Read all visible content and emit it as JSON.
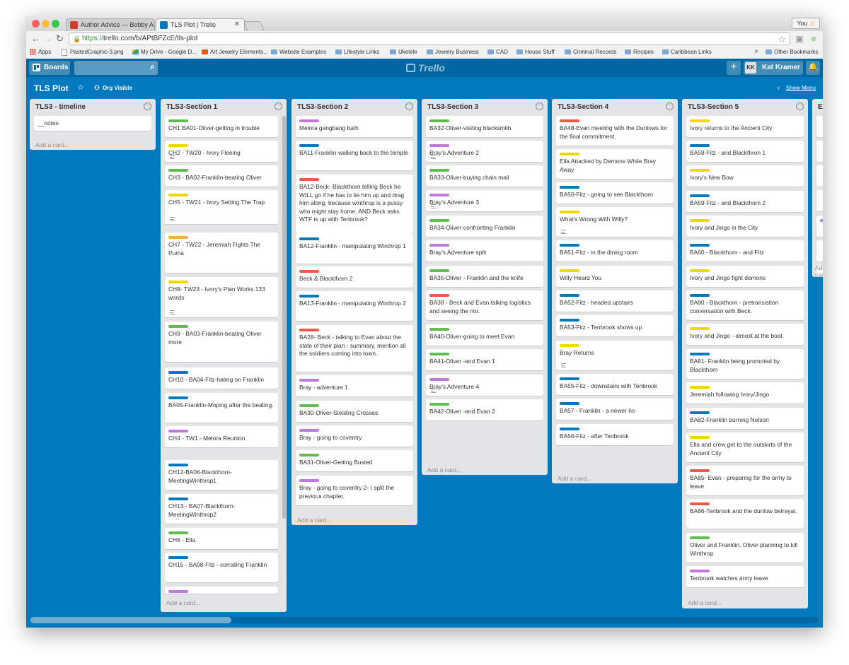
{
  "browser": {
    "tabs": [
      {
        "label": "Author Advice — Bobby A...",
        "favicon_color": "#d33b2c"
      },
      {
        "label": "TLS Plot | Trello",
        "favicon_color": "#0079bf"
      }
    ],
    "profile": "You",
    "url_scheme": "https://",
    "url_rest": "trello.com/b/APtBFZcE/tls-plot",
    "bookmarks": [
      "Apps",
      "PastedGraphic-3.png",
      "My Drive - Google D...",
      "Art Jewelry Elements...",
      "Website Examples",
      "Lifestyle Links",
      "Ukelele",
      "Jewelry Business",
      "CAD",
      "House Stuff",
      "Criminal Records",
      "Recipes",
      "Caribbean Links"
    ],
    "bookmark_more": "»",
    "other_bookmarks": "Other Bookmarks"
  },
  "header": {
    "boards_label": "Boards",
    "logo_text": "Trello",
    "user_initials": "KK",
    "user_name": "Kat Kramer",
    "add_symbol": "+"
  },
  "board": {
    "title": "TLS Plot",
    "visibility": "Org Visible",
    "show_menu": "Show Menu"
  },
  "colors": {
    "green": "#61bd4f",
    "yellow": "#f2d600",
    "orange": "#ffab4a",
    "red": "#eb5a46",
    "purple": "#c377e0",
    "blue": "#0079bf"
  },
  "add_card_label": "Add a card...",
  "lists": [
    {
      "title": "TLS3 - timeline",
      "cards": [
        {
          "label": null,
          "text": "__notes",
          "desc": false
        }
      ]
    },
    {
      "title": "TLS3-Section 1",
      "cards": [
        {
          "label": "green",
          "text": "CH1 BA01-Oliver-getting in trouble",
          "desc": false
        },
        {
          "label": "yellow",
          "text": "CH2 - TW20 - Ivory Fleeing",
          "desc": true
        },
        {
          "label": "green",
          "text": "CH3 - BA02-Franklin-beating Oliver",
          "desc": false
        },
        {
          "label": "yellow",
          "text": "CH5 - TW21 - Ivory Setting The Trap",
          "desc": true
        },
        {
          "label": "orange",
          "text": "CH7 - TW22 - Jeremiah Fights The Puma",
          "desc": false
        },
        {
          "label": "yellow",
          "text": "CH8- TW23 - Ivory's Plan Works 133 words",
          "desc": true
        },
        {
          "label": "green",
          "text": "CH9 - BA03-Franklin-beating Oliver more",
          "desc": false
        },
        {
          "label": "blue",
          "text": "CH10 - BA04-Fitz-hating on Franklin",
          "desc": false
        },
        {
          "label": "blue",
          "text": "BA05-Franklin-Moping after the beating.",
          "desc": false
        },
        {
          "label": "purple",
          "text": "CH4 - TW1 - Melora Reunion",
          "desc": false
        },
        {
          "label": "blue",
          "text": "CH12-BA06-Blackthorn-MeetingWinthrop1",
          "desc": false
        },
        {
          "label": "blue",
          "text": "CH13 - BA07-Blackthorn-MeetingWinthrop2",
          "desc": false
        },
        {
          "label": "green",
          "text": "CH6 - Ella",
          "desc": false
        },
        {
          "label": "blue",
          "text": "CH15 - BA08-Fitz - corralling Franklin",
          "desc": false
        },
        {
          "label": "purple",
          "text": "",
          "desc": false
        }
      ]
    },
    {
      "title": "TLS3-Section 2",
      "cards": [
        {
          "label": "purple",
          "text": "Melora gangbang bath",
          "desc": false
        },
        {
          "label": "blue",
          "text": "BA11-Franklin-walking back to the temple",
          "desc": false
        },
        {
          "label": "red",
          "text": "BA12-Beck- Blackthorn telling Beck he WILL go if he has to tie him up and drag him along. because winthrop is a pussy who might stay home. AND Beck asks WTF is up with Tenbrook?",
          "desc": false
        },
        {
          "label": "blue",
          "text": "BA12-Franklin - manipulating Winthrop 1",
          "desc": false
        },
        {
          "label": "red",
          "text": "Beck & Blackthorn 2",
          "desc": false
        },
        {
          "label": "blue",
          "text": "BA13-Franklin - manipulating Winthrop 2",
          "desc": false
        },
        {
          "label": "red",
          "text": "BA28- Beck - talking to Evan about the state of their plan - summary. mention all the soldiers coming into town.",
          "desc": false
        },
        {
          "label": "purple",
          "text": "Bray - adventure 1",
          "desc": false
        },
        {
          "label": "green",
          "text": "BA30-Oliver-Stealing Crosses",
          "desc": false
        },
        {
          "label": "purple",
          "text": "Bray - going to coventry",
          "desc": false
        },
        {
          "label": "green",
          "text": "BA31-Oliver-Getting Busted",
          "desc": false
        },
        {
          "label": "purple",
          "text": "Bray - going to coventry 2- I split the previous chapter.",
          "desc": false
        }
      ]
    },
    {
      "title": "TLS3-Section 3",
      "cards": [
        {
          "label": "green",
          "text": "BA32-Oliver-visiting blacksmith",
          "desc": false
        },
        {
          "label": "purple",
          "text": "Bray's Adventure 2",
          "desc": true
        },
        {
          "label": "green",
          "text": "BA33-Oliver-buying chain mail",
          "desc": false
        },
        {
          "label": "purple",
          "text": "Bray's Adventure 3",
          "desc": true
        },
        {
          "label": "green",
          "text": "BA34-Oliver-confronting Franklin",
          "desc": false
        },
        {
          "label": "purple",
          "text": "Bray's Adventure split",
          "desc": false
        },
        {
          "label": "green",
          "text": "BA35-Oliver - Franklin and the knife",
          "desc": false
        },
        {
          "label": "red",
          "text": "BA38 - Beck and Evan talking logistics and seeing the riot.",
          "desc": false
        },
        {
          "label": "green",
          "text": "BA40-Oliver-going to meet Evan",
          "desc": false
        },
        {
          "label": "green",
          "text": "BA41-Oliver -and Evan 1",
          "desc": false
        },
        {
          "label": "purple",
          "text": "Bray's Adventure 4",
          "desc": true
        },
        {
          "label": "green",
          "text": "BA42-Oliver -and Evan 2",
          "desc": false
        }
      ]
    },
    {
      "title": "TLS3-Section 4",
      "cards": [
        {
          "label": "red",
          "text": "BA48-Evan meeting with the Dunlows for the final commitment.",
          "desc": false
        },
        {
          "label": "yellow",
          "text": "Ella Attacked by Demons While Bray Away",
          "desc": false
        },
        {
          "label": "blue",
          "text": "BA50-Fitz - going to see Blackthorn",
          "desc": false
        },
        {
          "label": "yellow",
          "text": "What's Wrong With Willy?",
          "desc": true
        },
        {
          "label": "blue",
          "text": "BA51-Fitz - in the dining room",
          "desc": false
        },
        {
          "label": "yellow",
          "text": "Willy Heard You",
          "desc": false
        },
        {
          "label": "blue",
          "text": "BA52-Fitz - headed upstairs",
          "desc": false
        },
        {
          "label": "blue",
          "text": "BA53-Fitz - Tenbrook shows up",
          "desc": false
        },
        {
          "label": "yellow",
          "text": "Bray Returns",
          "desc": true
        },
        {
          "label": "blue",
          "text": "BA55-Fitz - downstairs with Tenbrook",
          "desc": false
        },
        {
          "label": "blue",
          "text": "BA57 - Franklin - a newer ho",
          "desc": false
        },
        {
          "label": "blue",
          "text": "BA56-Fitz - after Tenbrook",
          "desc": false
        }
      ]
    },
    {
      "title": "TLS3-Section 5",
      "cards": [
        {
          "label": "yellow",
          "text": "Ivory returns to the Ancient City",
          "desc": false
        },
        {
          "label": "blue",
          "text": "BA58-Fitz - and Blackthron 1",
          "desc": false
        },
        {
          "label": "yellow",
          "text": "Ivory's New Bow",
          "desc": false
        },
        {
          "label": "blue",
          "text": "BA59-Fitz - and Blackthorn 2",
          "desc": false
        },
        {
          "label": "yellow",
          "text": "Ivory and Jingo in the City",
          "desc": false
        },
        {
          "label": "blue",
          "text": "BA60 - Blackthorn - and Fitz",
          "desc": false
        },
        {
          "label": "yellow",
          "text": "Ivory and Jingo fight demons",
          "desc": false
        },
        {
          "label": "blue",
          "text": "BA80 - Blackthorn - pretransistion conversation with Beck.",
          "desc": false
        },
        {
          "label": "yellow",
          "text": "Ivory and Jingo - almost at the boat",
          "desc": false
        },
        {
          "label": "blue",
          "text": "BA81- Franklin being promoted by Blackthorn",
          "desc": false
        },
        {
          "label": "yellow",
          "text": "Jeremiah following Ivory/Jingo",
          "desc": false
        },
        {
          "label": "blue",
          "text": "BA82-Franklin burning Nelson",
          "desc": false
        },
        {
          "label": "yellow",
          "text": "Ella and crew get to the outskirts of the Ancient City",
          "desc": false
        },
        {
          "label": "red",
          "text": "BA85- Evan - preparing for the army to leave",
          "desc": false
        },
        {
          "label": "red",
          "text": "BA86-Tenbrook and the dunlow betrayal.",
          "desc": false
        },
        {
          "label": "green",
          "text": "Oliver and Franklin. Oliver planning to kill Winthrop",
          "desc": false
        },
        {
          "label": "purple",
          "text": "Tenbrook watches army leave",
          "desc": false
        }
      ]
    },
    {
      "title": "El",
      "cards": [
        {
          "label": null,
          "text": "",
          "desc": false
        },
        {
          "label": null,
          "text": "",
          "desc": false
        },
        {
          "label": null,
          "text": "",
          "desc": false
        },
        {
          "label": null,
          "text": "",
          "desc": false
        },
        {
          "label": "purple",
          "text": "",
          "desc": false
        },
        {
          "label": null,
          "text": "",
          "desc": false
        },
        {
          "label": null,
          "text": "",
          "desc": false
        },
        {
          "label": null,
          "text": "",
          "desc": false
        }
      ]
    }
  ]
}
